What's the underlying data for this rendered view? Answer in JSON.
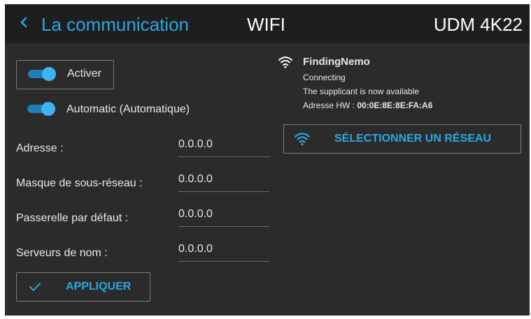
{
  "header": {
    "back_icon": "chevron-left-icon",
    "back_label": "La communication",
    "section_title": "WIFI",
    "device_name": "UDM 4K22"
  },
  "settings": {
    "activate_label": "Activer",
    "activate_on": true,
    "automatic_label": "Automatic (Automatique)",
    "automatic_on": true,
    "fields": [
      {
        "label": "Adresse :",
        "value": "0.0.0.0"
      },
      {
        "label": "Masque de sous-réseau :",
        "value": "0.0.0.0"
      },
      {
        "label": "Passerelle par défaut :",
        "value": "0.0.0.0"
      },
      {
        "label": "Serveurs de nom :",
        "value": "0.0.0.0"
      }
    ],
    "apply_label": "APPLIQUER",
    "apply_icon": "check-icon"
  },
  "network": {
    "ssid": "FindingNemo",
    "status": "Connecting",
    "message": "The supplicant is now available",
    "hw_label": "Adresse HW : ",
    "hw_value": "00:0E:8E:8E:FA:A6",
    "select_label": "SÉLECTIONNER UN RÉSEAU",
    "wifi_icon": "wifi-icon"
  },
  "colors": {
    "accent": "#29a8e0",
    "background": "#2b2b2b",
    "header": "#1e1e1e"
  }
}
